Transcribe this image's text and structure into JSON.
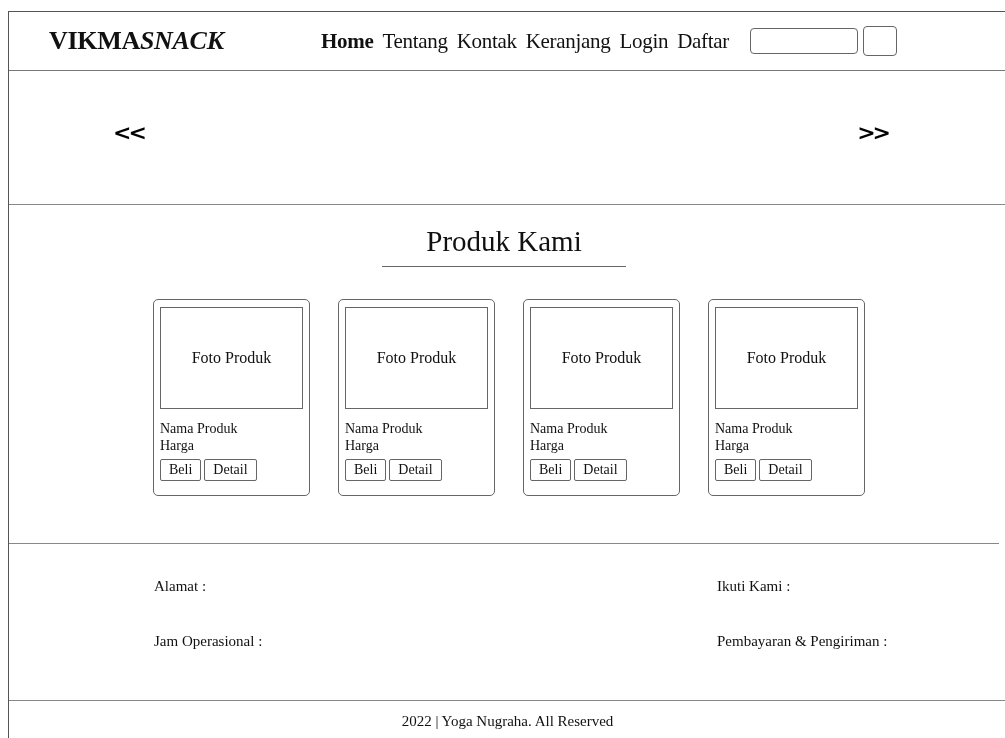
{
  "header": {
    "logo": {
      "plain": "VIKMA",
      "italic": "SNACK"
    },
    "nav": [
      {
        "label": "Home",
        "selected": true
      },
      {
        "label": "Tentang",
        "selected": false
      },
      {
        "label": "Kontak",
        "selected": false
      },
      {
        "label": "Keranjang",
        "selected": false
      },
      {
        "label": "Login",
        "selected": false
      },
      {
        "label": "Daftar",
        "selected": false
      }
    ]
  },
  "slider": {
    "prev": "<<",
    "next": ">>"
  },
  "products": {
    "title": "Produk Kami",
    "items": [
      {
        "photo": "Foto Produk",
        "name": "Nama Produk",
        "price": "Harga",
        "buy": "Beli",
        "detail": "Detail"
      },
      {
        "photo": "Foto Produk",
        "name": "Nama Produk",
        "price": "Harga",
        "buy": "Beli",
        "detail": "Detail"
      },
      {
        "photo": "Foto Produk",
        "name": "Nama Produk",
        "price": "Harga",
        "buy": "Beli",
        "detail": "Detail"
      },
      {
        "photo": "Foto Produk",
        "name": "Nama Produk",
        "price": "Harga",
        "buy": "Beli",
        "detail": "Detail"
      }
    ]
  },
  "footer": {
    "left": [
      "Alamat :",
      "Jam Operasional :"
    ],
    "right": [
      "Ikuti Kami :",
      "Pembayaran & Pengiriman :"
    ],
    "copyright": "2022 | Yoga Nugraha. All Reserved"
  }
}
